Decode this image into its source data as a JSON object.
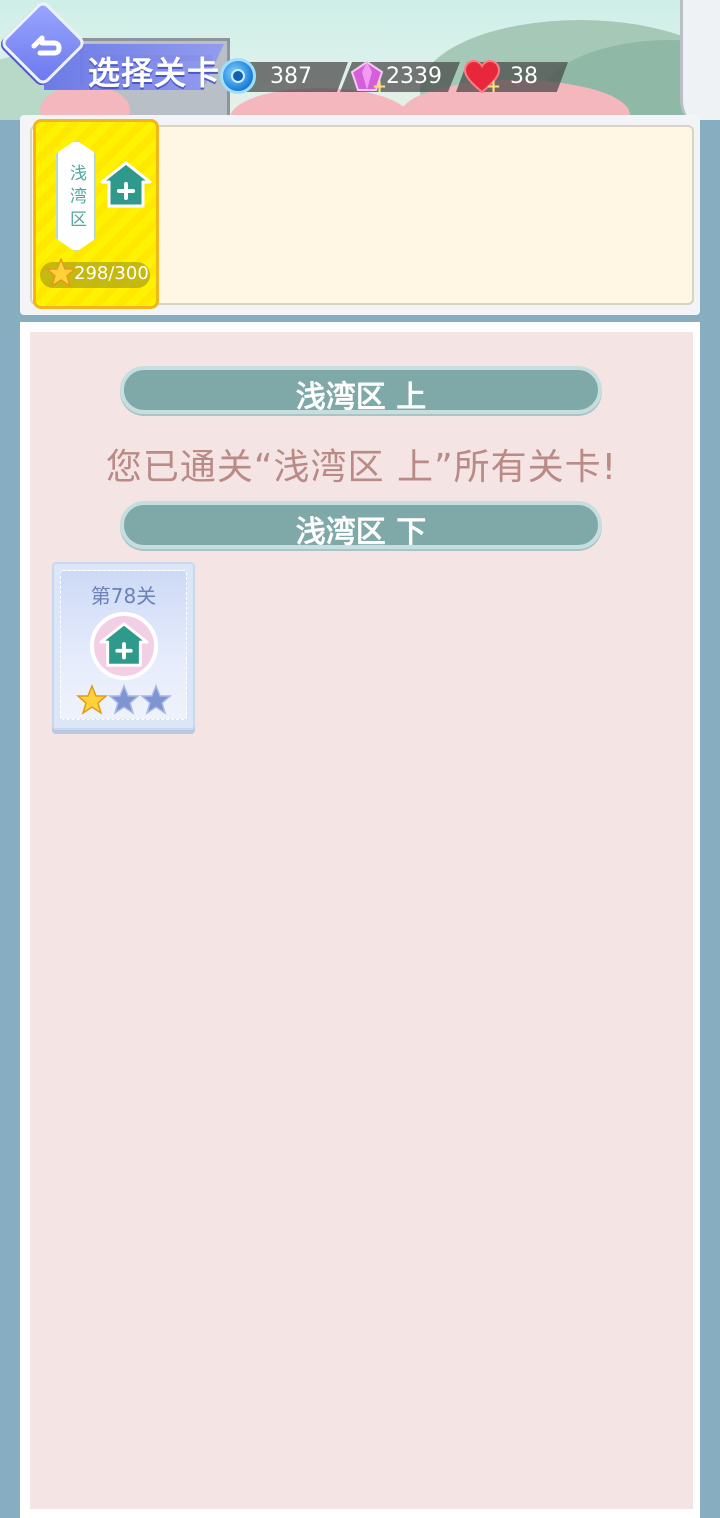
{
  "header": {
    "title": "选择关卡",
    "resources": {
      "coins": "387",
      "gems": "2339",
      "lives": "38"
    }
  },
  "area_selector": {
    "areas": [
      {
        "name": "浅湾区",
        "stars": "298/300",
        "selected": true
      }
    ]
  },
  "level_list": {
    "sections": [
      {
        "title": "浅湾区 上",
        "cleared_message": "您已通关“浅湾区 上”所有关卡!"
      },
      {
        "title": "浅湾区 下",
        "levels": [
          {
            "name": "第78关",
            "stars_earned": 1,
            "stars_total": 3
          }
        ]
      }
    ]
  },
  "colors": {
    "accent": "#7fa8a8",
    "selected_card": "#fff200",
    "page_bg": "#86adc0",
    "list_bg": "#f4e4e4"
  }
}
